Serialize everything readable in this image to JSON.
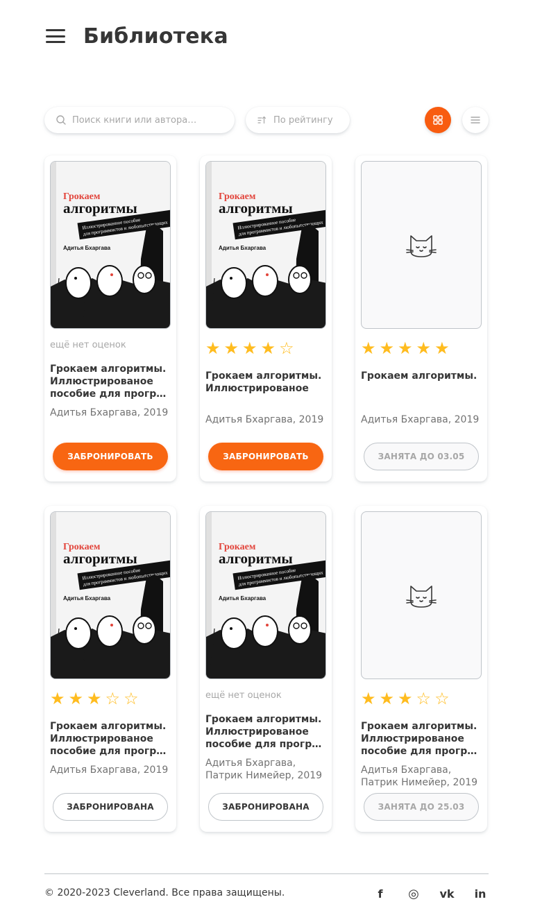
{
  "header": {
    "title": "Библиотека"
  },
  "toolbar": {
    "search_placeholder": "Поиск книги или автора…",
    "sort_label": "По рейтингу"
  },
  "colors": {
    "accent": "#f86612",
    "star": "#ffbc1f",
    "border": "#bfc4c9"
  },
  "cards": [
    {
      "cover": "book",
      "rating_text": "ещё нет оценок",
      "stars": null,
      "title_lines": [
        "Грокаем алгоритмы.",
        "Иллюстрированое",
        "пособие для програ…"
      ],
      "author_lines": [
        "Адитья Бхаргава, 2019"
      ],
      "button": "ЗАБРОНИРОВАТЬ",
      "button_state": "primary"
    },
    {
      "cover": "book",
      "rating_text": null,
      "stars": 4,
      "title_lines": [
        "Грокаем алгоритмы.",
        "Иллюстрированое"
      ],
      "author_lines": [
        "Адитья Бхаргава, 2019"
      ],
      "button": "ЗАБРОНИРОВАТЬ",
      "button_state": "primary"
    },
    {
      "cover": "empty",
      "rating_text": null,
      "stars": 5,
      "title_lines": [
        "Грокаем алгоритмы."
      ],
      "author_lines": [
        "Адитья Бхаргава, 2019"
      ],
      "button": "ЗАНЯТА ДО 03.05",
      "button_state": "busy"
    },
    {
      "cover": "book",
      "rating_text": null,
      "stars": 3,
      "title_lines": [
        "Грокаем алгоритмы.",
        "Иллюстрированое",
        "пособие для програ…"
      ],
      "author_lines": [
        "Адитья Бхаргава, 2019"
      ],
      "button": "ЗАБРОНИРОВАНА",
      "button_state": "booked"
    },
    {
      "cover": "book",
      "rating_text": "ещё нет оценок",
      "stars": null,
      "title_lines": [
        "Грокаем алгоритмы.",
        "Иллюстрированое",
        "пособие для програ…"
      ],
      "author_lines": [
        "Адитья Бхаргава,",
        "Патрик Нимейер, 2019"
      ],
      "button": "ЗАБРОНИРОВАНА",
      "button_state": "booked"
    },
    {
      "cover": "empty",
      "rating_text": null,
      "stars": 3,
      "title_lines": [
        "Грокаем алгоритмы.",
        "Иллюстрированое",
        "пособие для програ…"
      ],
      "author_lines": [
        "Адитья Бхаргава,",
        "Патрик Нимейер, 2019"
      ],
      "button": "ЗАНЯТА ДО 25.03",
      "button_state": "busy"
    }
  ],
  "book_cover": {
    "title_top": "Грокаем",
    "title_main": "алгоритмы",
    "subtitle_1": "Иллюстрированное пособие",
    "subtitle_2": "для программистов и любопытствующих",
    "author": "Адитья Бхаргава"
  },
  "footer": {
    "copyright": "© 2020-2023 Cleverland. Все права защищены.",
    "social_icons": [
      "facebook-icon",
      "instagram-icon",
      "vk-icon",
      "linkedin-icon"
    ],
    "social_glyphs": [
      "f",
      "◎",
      "vk",
      "in"
    ]
  }
}
